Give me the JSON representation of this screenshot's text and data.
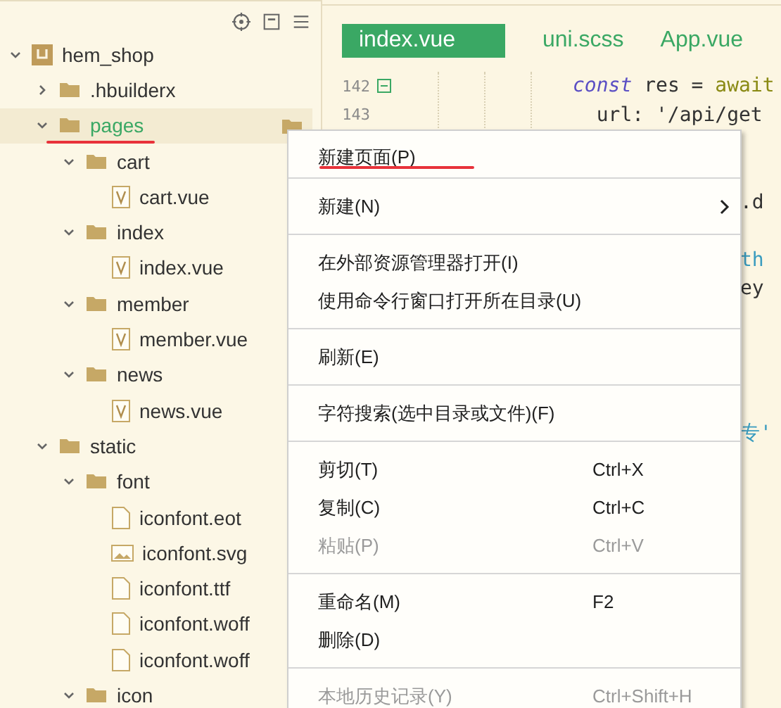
{
  "sidebar": {
    "tree": [
      {
        "label": "hem_shop",
        "kind": "project",
        "expanded": true,
        "selected": false,
        "children": [
          {
            "label": ".hbuilderx",
            "kind": "folder",
            "expanded": false,
            "selected": false
          },
          {
            "label": "pages",
            "kind": "folder",
            "expanded": true,
            "selected": true,
            "children": [
              {
                "label": "cart",
                "kind": "folder",
                "expanded": true,
                "selected": false,
                "children": [
                  {
                    "label": "cart.vue",
                    "kind": "vue",
                    "selected": false
                  }
                ]
              },
              {
                "label": "index",
                "kind": "folder",
                "expanded": true,
                "selected": false,
                "children": [
                  {
                    "label": "index.vue",
                    "kind": "vue",
                    "selected": false
                  }
                ]
              },
              {
                "label": "member",
                "kind": "folder",
                "expanded": true,
                "selected": false,
                "children": [
                  {
                    "label": "member.vue",
                    "kind": "vue",
                    "selected": false
                  }
                ]
              },
              {
                "label": "news",
                "kind": "folder",
                "expanded": true,
                "selected": false,
                "children": [
                  {
                    "label": "news.vue",
                    "kind": "vue",
                    "selected": false
                  }
                ]
              }
            ]
          },
          {
            "label": "static",
            "kind": "folder",
            "expanded": true,
            "selected": false,
            "children": [
              {
                "label": "font",
                "kind": "folder",
                "expanded": true,
                "selected": false,
                "children": [
                  {
                    "label": "iconfont.eot",
                    "kind": "file",
                    "selected": false
                  },
                  {
                    "label": "iconfont.svg",
                    "kind": "image",
                    "selected": false
                  },
                  {
                    "label": "iconfont.ttf",
                    "kind": "file",
                    "selected": false
                  },
                  {
                    "label": "iconfont.woff",
                    "kind": "file",
                    "selected": false
                  },
                  {
                    "label": "iconfont.woff",
                    "kind": "file",
                    "selected": false
                  }
                ]
              },
              {
                "label": "icon",
                "kind": "folder",
                "expanded": true,
                "selected": false
              }
            ]
          }
        ]
      }
    ]
  },
  "editor": {
    "tabs": [
      {
        "label": "index.vue",
        "selected": true
      },
      {
        "label": "uni.scss",
        "selected": false
      },
      {
        "label": "App.vue",
        "selected": false
      }
    ],
    "lines": [
      {
        "kind": "code",
        "number": "142",
        "foldable": true,
        "code": [
          {
            "text": "const",
            "kind": "keyword"
          },
          {
            "text": " res = ",
            "kind": "plain"
          },
          {
            "text": "await",
            "kind": "builtin"
          }
        ]
      },
      {
        "kind": "code",
        "number": "143",
        "foldable": false,
        "code": [
          {
            "text": "  url: '/api/get",
            "kind": "plain"
          }
        ]
      },
      {
        "kind": "blank"
      },
      {
        "kind": "blank"
      },
      {
        "kind": "tail",
        "code": [
          {
            "text": ".d",
            "kind": "plain"
          }
        ]
      },
      {
        "kind": "blank"
      },
      {
        "kind": "tail",
        "code": [
          {
            "text": "th",
            "kind": "link"
          }
        ]
      },
      {
        "kind": "tail",
        "code": [
          {
            "text": "ey",
            "kind": "plain"
          }
        ]
      },
      {
        "kind": "blank"
      },
      {
        "kind": "blank"
      },
      {
        "kind": "blank"
      },
      {
        "kind": "blank"
      },
      {
        "kind": "tail",
        "code": [
          {
            "text": "专'",
            "kind": "link"
          }
        ]
      }
    ]
  },
  "context_menu": {
    "groups": [
      [
        {
          "label": "新建页面(P)",
          "disabled": false,
          "submenu": false
        }
      ],
      [
        {
          "label": "新建(N)",
          "disabled": false,
          "submenu": true
        }
      ],
      [
        {
          "label": "在外部资源管理器打开(I)",
          "disabled": false,
          "submenu": false
        },
        {
          "label": "使用命令行窗口打开所在目录(U)",
          "disabled": false,
          "submenu": false
        }
      ],
      [
        {
          "label": "刷新(E)",
          "disabled": false,
          "submenu": false
        }
      ],
      [
        {
          "label": "字符搜索(选中目录或文件)(F)",
          "disabled": false,
          "submenu": false
        }
      ],
      [
        {
          "label": "剪切(T)",
          "shortcut": "Ctrl+X",
          "disabled": false,
          "submenu": false
        },
        {
          "label": "复制(C)",
          "shortcut": "Ctrl+C",
          "disabled": false,
          "submenu": false
        },
        {
          "label": "粘贴(P)",
          "shortcut": "Ctrl+V",
          "disabled": true,
          "submenu": false
        }
      ],
      [
        {
          "label": "重命名(M)",
          "shortcut": "F2",
          "disabled": false,
          "submenu": false
        },
        {
          "label": "删除(D)",
          "disabled": false,
          "submenu": false
        }
      ],
      [
        {
          "label": "本地历史记录(Y)",
          "shortcut": "Ctrl+Shift+H",
          "disabled": true,
          "submenu": false
        }
      ]
    ]
  }
}
